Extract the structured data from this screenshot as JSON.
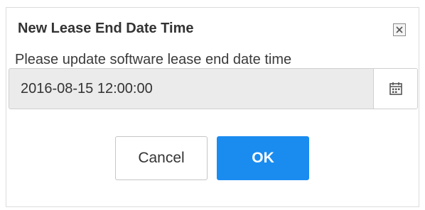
{
  "dialog": {
    "title": "New Lease End Date Time",
    "message": "Please update software lease end date time",
    "close_icon": "close-icon",
    "date_field": {
      "value": "2016-08-15 12:00:00",
      "icon": "calendar-icon"
    },
    "buttons": {
      "cancel_label": "Cancel",
      "ok_label": "OK"
    },
    "colors": {
      "ok_background": "#1a8cf0",
      "field_background": "#ebebeb"
    }
  }
}
